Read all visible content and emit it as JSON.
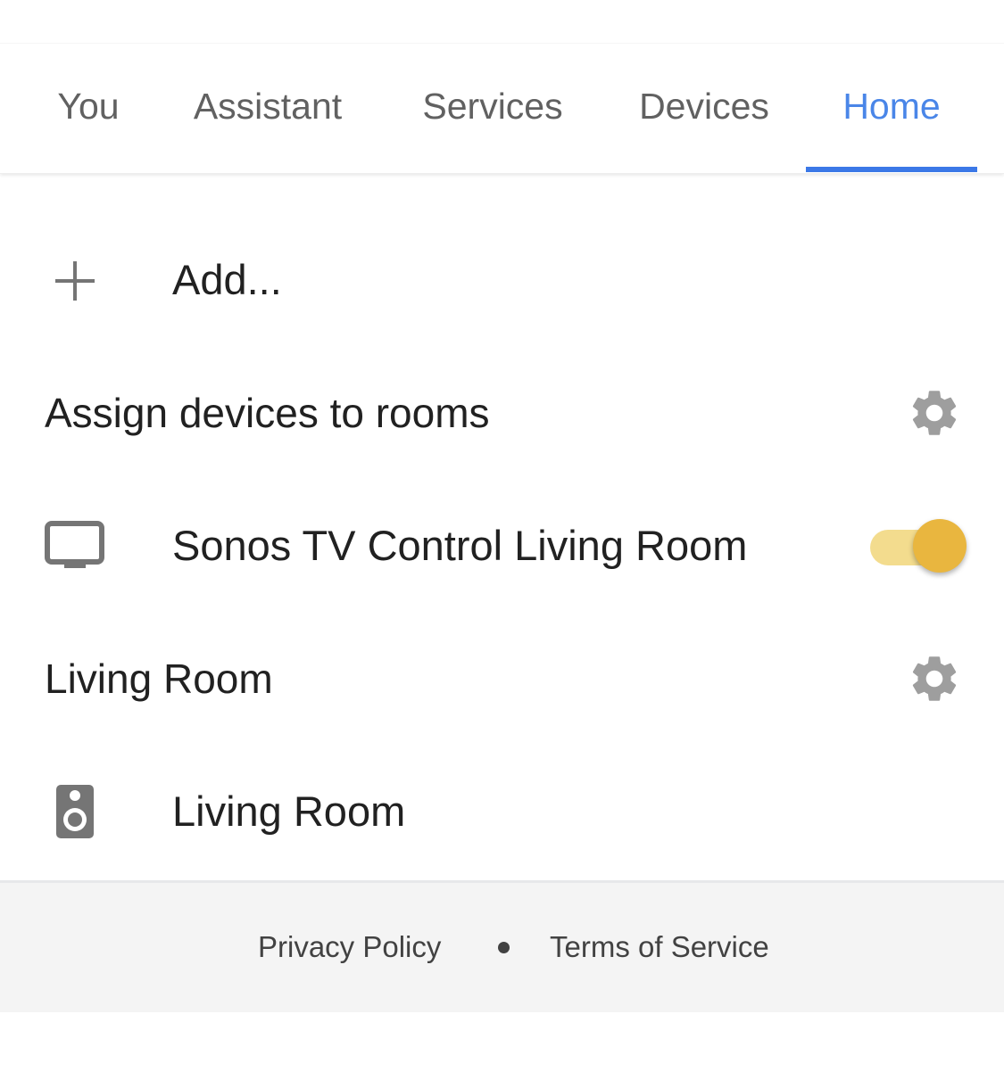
{
  "tabs": [
    {
      "label": "You",
      "active": false
    },
    {
      "label": "Assistant",
      "active": false
    },
    {
      "label": "Services",
      "active": false
    },
    {
      "label": "Devices",
      "active": false
    },
    {
      "label": "Home",
      "active": true
    }
  ],
  "colors": {
    "accent": "#4a86e8",
    "toggle_track": "#f3dc8e",
    "toggle_knob": "#e9b63f",
    "icon_gray": "#757575"
  },
  "add": {
    "icon": "plus-icon",
    "label": "Add..."
  },
  "sections": [
    {
      "title": "Assign devices to rooms",
      "settings_icon": "gear-icon",
      "items": [
        {
          "icon": "tv-icon",
          "label": "Sonos TV Control Living Room",
          "toggle_on": true
        }
      ]
    },
    {
      "title": "Living Room",
      "settings_icon": "gear-icon",
      "items": [
        {
          "icon": "speaker-icon",
          "label": "Living Room"
        }
      ]
    }
  ],
  "footer": {
    "privacy_label": "Privacy Policy",
    "separator": "•",
    "terms_label": "Terms of Service"
  }
}
